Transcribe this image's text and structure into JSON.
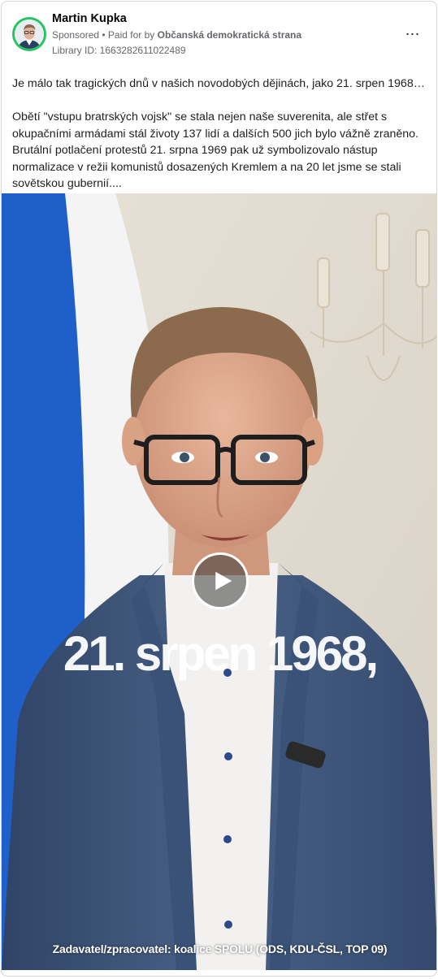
{
  "post": {
    "author": "Martin Kupka",
    "sponsored": "Sponsored",
    "paid_for_prefix": " • Paid for by ",
    "paid_for_by": "Občanská demokratická strana",
    "library_id": "Library ID: 1663282611022489",
    "more_icon": "⋯",
    "text_paragraph_1": "Je málo tak tragických dnů v našich novodobých dějinách, jako 21. srpen 1968…",
    "text_paragraph_2": "Obětí \"vstupu bratrských vojsk\" se stala nejen naše suverenita, ale střet s okupačními armádami stál životy 137 lidí a dalších 500 jich bylo vážně zraněno. Brutální potlačení protestů 21. srpna 1969 pak už symbolizovalo nástup normalizace v režii komunistů dosazených Kremlem a na 20 let jsme se stali sovětskou gubernií...."
  },
  "video": {
    "overlay_title": "21. srpen 1968,",
    "caption": "Zadavatel/zpracovatel: koalice SPOLU (ODS, KDU-ČSL, TOP 09)",
    "play_icon": "play-icon"
  },
  "colors": {
    "avatar_ring": "#22c55e",
    "flag_blue": "#1f5fc9",
    "flag_white": "#f4f4f4",
    "suit": "#3d5476"
  }
}
